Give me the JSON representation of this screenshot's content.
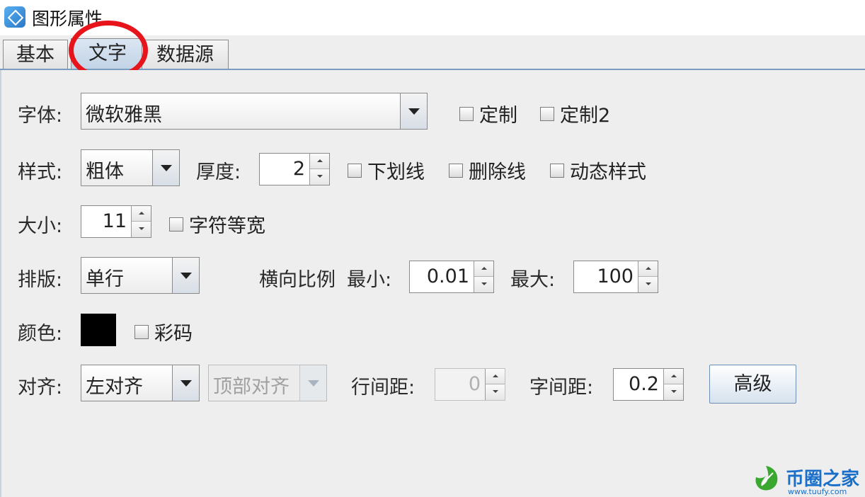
{
  "window": {
    "title": "图形属性"
  },
  "tabs": [
    {
      "label": "基本",
      "active": false
    },
    {
      "label": "文字",
      "active": true
    },
    {
      "label": "数据源",
      "active": false
    }
  ],
  "highlight_color": "#e8141c",
  "font_row": {
    "label": "字体:",
    "value": "微软雅黑",
    "custom1_label": "定制",
    "custom2_label": "定制2"
  },
  "style_row": {
    "label": "样式:",
    "value": "粗体",
    "thickness_label": "厚度:",
    "thickness_value": "2",
    "underline_label": "下划线",
    "strikethrough_label": "删除线",
    "dynamic_label": "动态样式"
  },
  "size_row": {
    "label": "大小:",
    "value": "11",
    "monospace_label": "字符等宽"
  },
  "layout_row": {
    "label": "排版:",
    "value": "单行",
    "scale_label": "横向比例",
    "min_label": "最小:",
    "min_value": "0.01",
    "max_label": "最大:",
    "max_value": "100"
  },
  "color_row": {
    "label": "颜色:",
    "color": "#000000",
    "colorful_label": "彩码"
  },
  "align_row": {
    "label": "对齐:",
    "h_value": "左对齐",
    "v_value": "顶部对齐",
    "line_spacing_label": "行间距:",
    "line_spacing_value": "0",
    "char_spacing_label": "字间距:",
    "char_spacing_value": "0.2",
    "advanced_label": "高级"
  },
  "watermark": {
    "name": "币圈之家",
    "url": "www.tuufy.com"
  }
}
